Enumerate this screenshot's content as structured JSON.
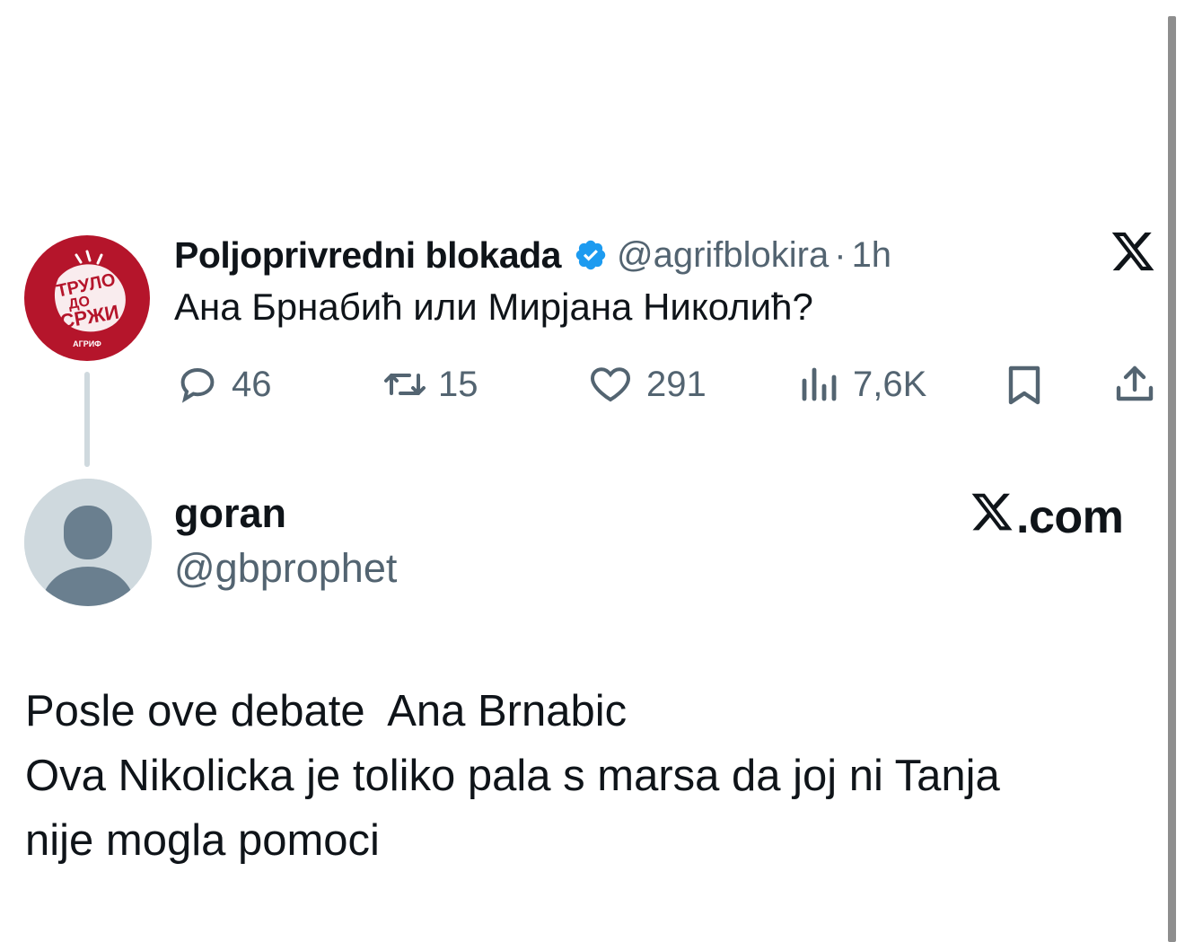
{
  "original_tweet": {
    "avatar_text": "ТРУЛО ДО СРЖИ",
    "avatar_subtext": "АГРИФ",
    "display_name": "Poljoprivredni blokada",
    "handle": "@agrifblokira",
    "separator": "·",
    "time": "1h",
    "text": "Ана Брнабић или Мирјана Николић?",
    "stats": {
      "replies": "46",
      "reposts": "15",
      "likes": "291",
      "views": "7,6K"
    },
    "icons": {
      "platform": "x-logo-icon",
      "verified": "verified-badge-icon",
      "reply": "reply-icon",
      "repost": "repost-icon",
      "like": "heart-icon",
      "views": "views-icon",
      "bookmark": "bookmark-icon",
      "share": "share-icon"
    },
    "colors": {
      "verified": "#1d9bf0",
      "avatar_bg": "#b5152b"
    }
  },
  "reply_card": {
    "display_name": "goran",
    "handle": "@gbprophet",
    "brand": ".com",
    "lines": [
      "Posle ove debate  Ana Brnabic",
      "Ova Nikolicka je toliko pala s marsa da joj ni Tanja",
      "nije mogla pomoci"
    ]
  }
}
